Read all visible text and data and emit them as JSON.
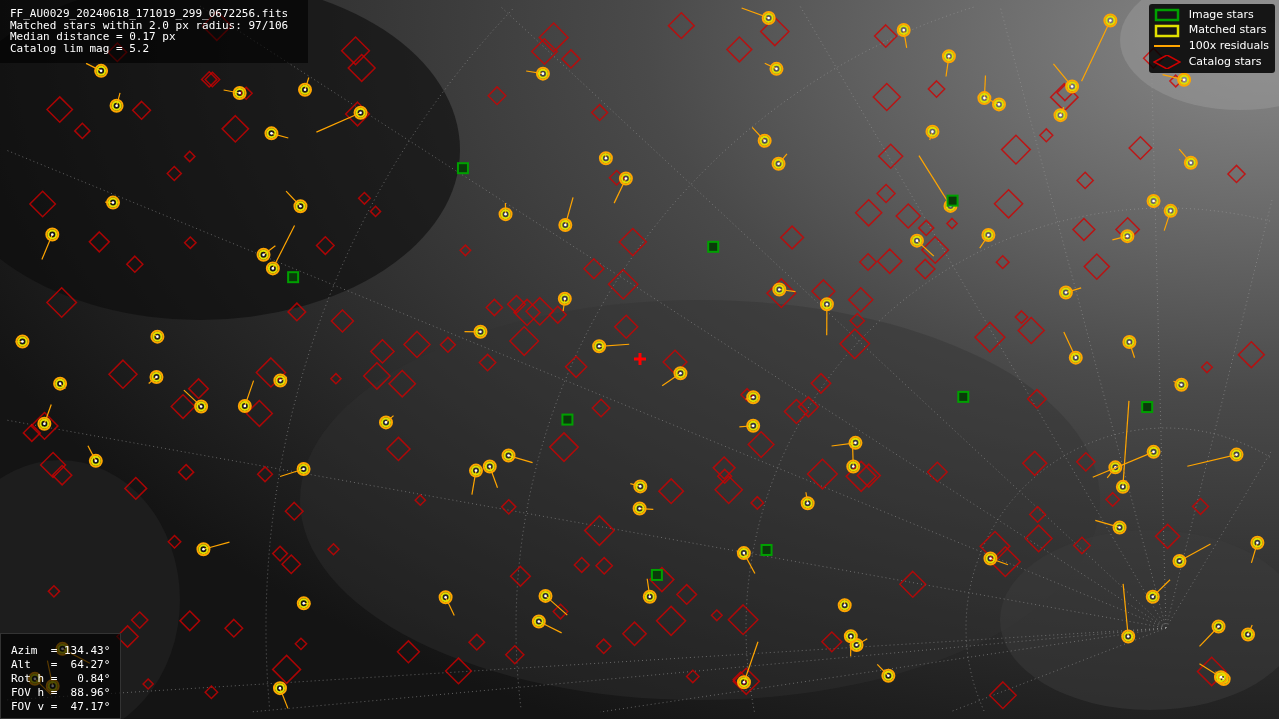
{
  "header_info": [
    "FF_AU0029_20240618_171019_299_0672256.fits",
    "Matched stars within 2.0 px radius: 97/106",
    "Median distance = 0.17 px",
    "Catalog lim mag = 5.2"
  ],
  "legend": [
    {
      "label": "Image stars",
      "color": "#00a000"
    },
    {
      "kind": "matched",
      "label": "Matched stars",
      "color": "#e0e000"
    },
    {
      "kind": "residual",
      "label": "100x residuals",
      "color": "#ffa500"
    },
    {
      "kind": "catalog",
      "label": "Catalog stars",
      "color": "#d00000"
    }
  ],
  "pointing_info": [
    "Azim  = 134.43°",
    "Alt   =  64.27°",
    "Rot h =   0.84°",
    "FOV h =  88.96°",
    "FOV v =  47.17°"
  ]
}
